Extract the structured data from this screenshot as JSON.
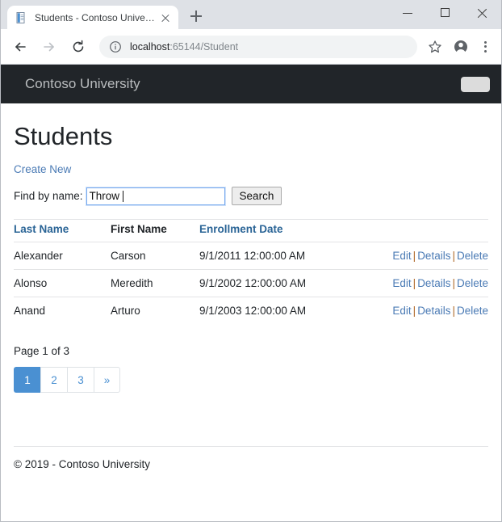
{
  "browser": {
    "tab": {
      "title": "Students - Contoso University",
      "favicon_name": "document-icon",
      "close_label": "x"
    },
    "new_tab_label": "+",
    "window_controls": {
      "minimize": "—",
      "maximize": "□",
      "close": "✕"
    },
    "toolbar": {
      "back_label": "Back",
      "forward_label": "Forward",
      "reload_label": "Reload",
      "info_label": "Site information",
      "url_host": "localhost",
      "url_rest": ":65144/Student",
      "bookmark_label": "Bookmark this page",
      "profile_label": "Profile",
      "menu_label": "Customize and control Google Chrome"
    }
  },
  "page": {
    "navbar": {
      "brand": "Contoso University",
      "toggler_label": "Toggle navigation"
    },
    "title": "Students",
    "create_new_label": "Create New",
    "search": {
      "label": "Find by name:",
      "value": "Throw",
      "placeholder": "",
      "button_label": "Search"
    },
    "table": {
      "columns": [
        {
          "label": "Last Name",
          "sortable": true
        },
        {
          "label": "First Name",
          "sortable": false
        },
        {
          "label": "Enrollment Date",
          "sortable": true
        },
        {
          "label": "",
          "sortable": false
        }
      ],
      "rows": [
        {
          "last_name": "Alexander",
          "first_name": "Carson",
          "enrollment_date": "9/1/2011 12:00:00 AM",
          "actions": {
            "edit": "Edit",
            "details": "Details",
            "delete": "Delete",
            "separator": "|"
          }
        },
        {
          "last_name": "Alonso",
          "first_name": "Meredith",
          "enrollment_date": "9/1/2002 12:00:00 AM",
          "actions": {
            "edit": "Edit",
            "details": "Details",
            "delete": "Delete",
            "separator": "|"
          }
        },
        {
          "last_name": "Anand",
          "first_name": "Arturo",
          "enrollment_date": "9/1/2003 12:00:00 AM",
          "actions": {
            "edit": "Edit",
            "details": "Details",
            "delete": "Delete",
            "separator": "|"
          }
        }
      ]
    },
    "page_info": "Page 1 of 3",
    "pagination": {
      "items": [
        {
          "label": "1",
          "active": true
        },
        {
          "label": "2",
          "active": false
        },
        {
          "label": "3",
          "active": false
        },
        {
          "label": "»",
          "active": false
        }
      ]
    },
    "footer": "© 2019 - Contoso University"
  },
  "colors": {
    "navbar_bg": "#212529",
    "link": "#4b7bb5",
    "header_link": "#2a6496",
    "pagination_active": "#4a90d2",
    "separator": "#b06a2c",
    "input_focus_border": "#77aaee"
  }
}
